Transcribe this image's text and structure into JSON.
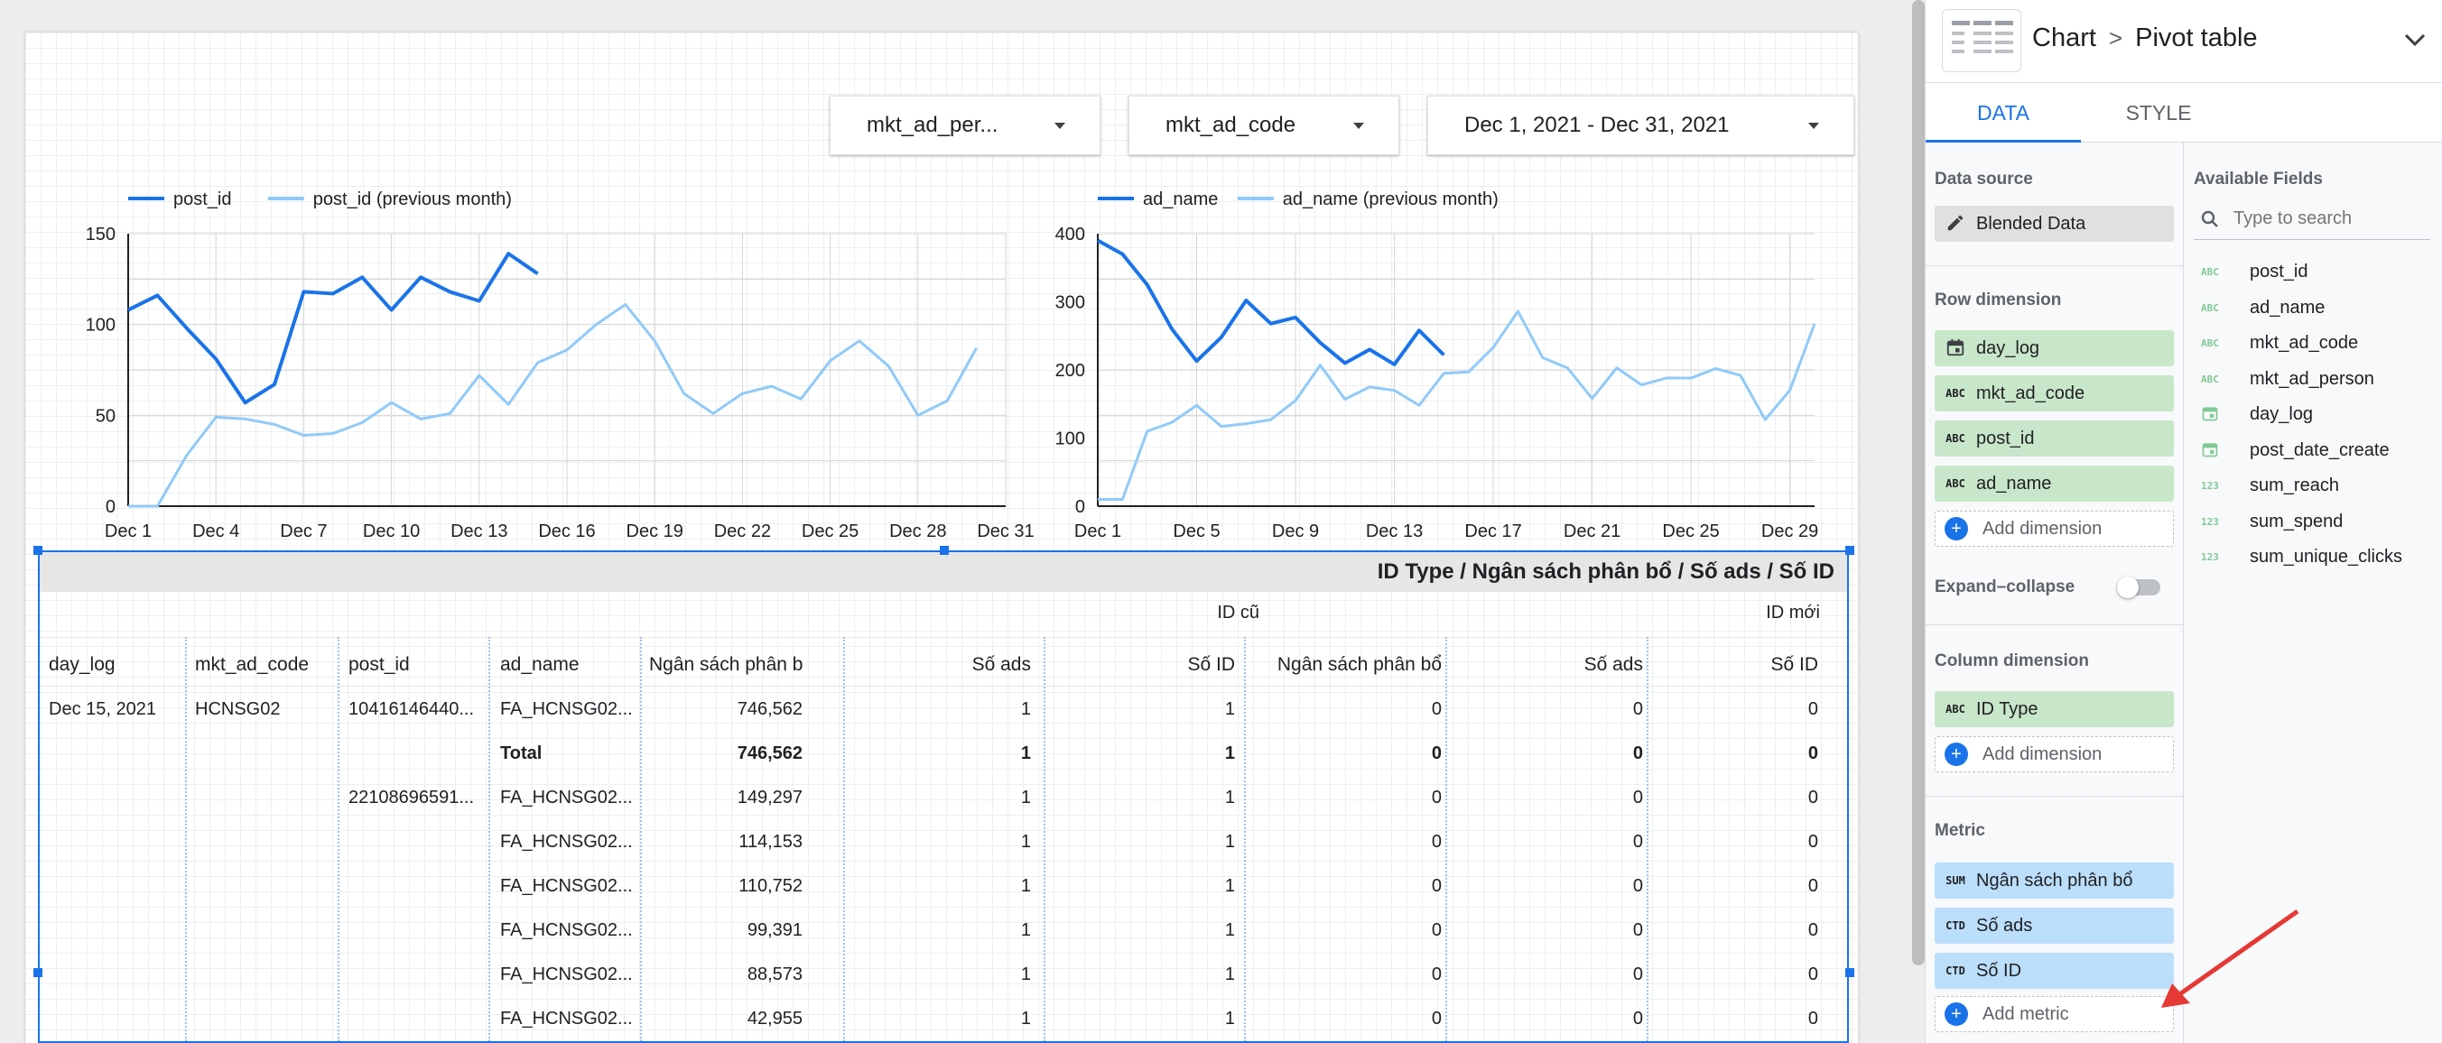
{
  "filters": {
    "f1": "mkt_ad_per...",
    "f2": "mkt_ad_code",
    "f3": "Dec 1, 2021 - Dec 31, 2021"
  },
  "chart_data": [
    {
      "type": "line",
      "legend_position": "top-left",
      "series": [
        {
          "name": "post_id",
          "color": "#1a73e8",
          "x": [
            1,
            2,
            3,
            4,
            5,
            6,
            7,
            8,
            9,
            10,
            11,
            12,
            13,
            14,
            15
          ],
          "values": [
            108,
            116,
            98,
            81,
            57,
            67,
            118,
            117,
            126,
            108,
            126,
            118,
            113,
            139,
            128
          ]
        },
        {
          "name": "post_id (previous month)",
          "color": "#90caf9",
          "x": [
            1,
            2,
            3,
            4,
            5,
            6,
            7,
            8,
            9,
            10,
            11,
            12,
            13,
            14,
            15,
            16,
            17,
            18,
            19,
            20,
            21,
            22,
            23,
            24,
            25,
            26,
            27,
            28,
            29,
            30
          ],
          "values": [
            0,
            0,
            28,
            49,
            48,
            45,
            39,
            40,
            46,
            57,
            48,
            51,
            72,
            56,
            79,
            86,
            100,
            111,
            91,
            62,
            51,
            62,
            66,
            59,
            80,
            91,
            77,
            50,
            58,
            87
          ]
        }
      ],
      "x_tick_labels": [
        "Dec 1",
        "Dec 4",
        "Dec 7",
        "Dec 10",
        "Dec 13",
        "Dec 16",
        "Dec 19",
        "Dec 22",
        "Dec 25",
        "Dec 28",
        "Dec 31"
      ],
      "x_tick_days": [
        1,
        4,
        7,
        10,
        13,
        16,
        19,
        22,
        25,
        28,
        31
      ],
      "y_ticks": [
        0,
        50,
        100,
        150
      ],
      "ylim": [
        0,
        150
      ],
      "xlim": [
        1,
        31
      ]
    },
    {
      "type": "line",
      "legend_position": "top-left",
      "series": [
        {
          "name": "ad_name",
          "color": "#1a73e8",
          "x": [
            1,
            2,
            3,
            4,
            5,
            6,
            7,
            8,
            9,
            10,
            11,
            12,
            13,
            14,
            15
          ],
          "values": [
            390,
            370,
            325,
            260,
            213,
            248,
            302,
            268,
            277,
            240,
            210,
            230,
            208,
            258,
            222
          ]
        },
        {
          "name": "ad_name (previous month)",
          "color": "#90caf9",
          "x": [
            1,
            2,
            3,
            4,
            5,
            6,
            7,
            8,
            9,
            10,
            11,
            12,
            13,
            14,
            15,
            16,
            17,
            18,
            19,
            20,
            21,
            22,
            23,
            24,
            25,
            26,
            27,
            28,
            29,
            30
          ],
          "values": [
            10,
            10,
            110,
            123,
            148,
            117,
            121,
            127,
            155,
            207,
            157,
            175,
            170,
            148,
            195,
            197,
            233,
            286,
            218,
            203,
            158,
            203,
            178,
            188,
            188,
            202,
            192,
            127,
            170,
            268
          ]
        }
      ],
      "x_tick_labels": [
        "Dec 1",
        "Dec 5",
        "Dec 9",
        "Dec 13",
        "Dec 17",
        "Dec 21",
        "Dec 25",
        "Dec 29"
      ],
      "x_tick_days": [
        1,
        5,
        9,
        13,
        17,
        21,
        25,
        29
      ],
      "y_ticks": [
        0,
        100,
        200,
        300,
        400
      ],
      "ylim": [
        0,
        400
      ],
      "xlim": [
        1,
        30
      ]
    }
  ],
  "table": {
    "title": "ID Type / Ngân sách phân bổ / Số ads / Số ID",
    "groups": [
      "ID cũ",
      "ID mới"
    ],
    "headers": [
      "day_log",
      "mkt_ad_code",
      "post_id",
      "ad_name",
      "Ngân sách phân bổ",
      "Số ads",
      "Số ID",
      "Ngân sách phân bổ",
      "Số ads",
      "Số ID"
    ],
    "rows": [
      [
        "Dec 15, 2021",
        "HCNSG02",
        "10416146440...",
        "FA_HCNSG02...",
        "746,562",
        "1",
        "1",
        "0",
        "0",
        "0"
      ],
      [
        "",
        "",
        "",
        "Total",
        "746,562",
        "1",
        "1",
        "0",
        "0",
        "0"
      ],
      [
        "",
        "",
        "22108696591...",
        "FA_HCNSG02...",
        "149,297",
        "1",
        "1",
        "0",
        "0",
        "0"
      ],
      [
        "",
        "",
        "",
        "FA_HCNSG02...",
        "114,153",
        "1",
        "1",
        "0",
        "0",
        "0"
      ],
      [
        "",
        "",
        "",
        "FA_HCNSG02...",
        "110,752",
        "1",
        "1",
        "0",
        "0",
        "0"
      ],
      [
        "",
        "",
        "",
        "FA_HCNSG02...",
        "99,391",
        "1",
        "1",
        "0",
        "0",
        "0"
      ],
      [
        "",
        "",
        "",
        "FA_HCNSG02...",
        "88,573",
        "1",
        "1",
        "0",
        "0",
        "0"
      ],
      [
        "",
        "",
        "",
        "FA_HCNSG02...",
        "42,955",
        "1",
        "1",
        "0",
        "0",
        "0"
      ]
    ]
  },
  "panel": {
    "breadcrumb_root": "Chart",
    "breadcrumb_sep": ">",
    "breadcrumb_current": "Pivot table",
    "tab_data": "DATA",
    "tab_style": "STYLE",
    "data_source_title": "Data source",
    "data_source": "Blended Data",
    "row_dim_title": "Row dimension",
    "row_dims": [
      {
        "icon": "calendar-icon",
        "label": "day_log"
      },
      {
        "icon": "ABC",
        "label": "mkt_ad_code"
      },
      {
        "icon": "ABC",
        "label": "post_id"
      },
      {
        "icon": "ABC",
        "label": "ad_name"
      }
    ],
    "add_dimension": "Add dimension",
    "expand_collapse": "Expand–collapse",
    "col_dim_title": "Column dimension",
    "col_dims": [
      {
        "icon": "ABC",
        "label": "ID Type"
      }
    ],
    "metric_title": "Metric",
    "metrics": [
      {
        "icon": "SUM",
        "label": "Ngân sách phân bổ"
      },
      {
        "icon": "CTD",
        "label": "Số ads"
      },
      {
        "icon": "CTD",
        "label": "Số ID"
      }
    ],
    "add_metric": "Add metric",
    "available_title": "Available Fields",
    "search_placeholder": "Type to search",
    "fields": [
      {
        "icon": "ABC",
        "label": "post_id"
      },
      {
        "icon": "ABC",
        "label": "ad_name"
      },
      {
        "icon": "ABC",
        "label": "mkt_ad_code"
      },
      {
        "icon": "ABC",
        "label": "mkt_ad_person"
      },
      {
        "icon": "calendar-icon",
        "label": "day_log"
      },
      {
        "icon": "calendar-icon",
        "label": "post_date_create"
      },
      {
        "icon": "123",
        "label": "sum_reach"
      },
      {
        "icon": "123",
        "label": "sum_spend"
      },
      {
        "icon": "123",
        "label": "sum_unique_clicks"
      }
    ]
  }
}
